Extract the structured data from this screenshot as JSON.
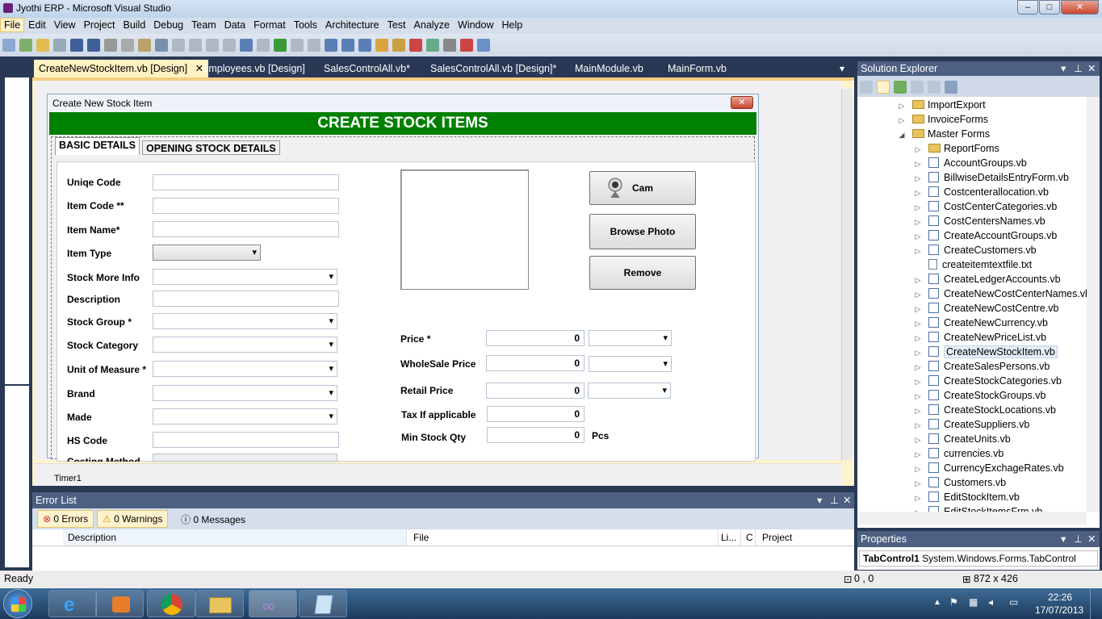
{
  "window": {
    "title": "Jyothi ERP - Microsoft Visual Studio",
    "min": "–",
    "max": "□",
    "close": "✕"
  },
  "menu": [
    "File",
    "Edit",
    "View",
    "Project",
    "Build",
    "Debug",
    "Team",
    "Data",
    "Format",
    "Tools",
    "Architecture",
    "Test",
    "Analyze",
    "Window",
    "Help"
  ],
  "doc_tabs": [
    {
      "label": "CreateNewStockItem.vb [Design]",
      "active": true
    },
    {
      "label": "Employees.vb [Design]"
    },
    {
      "label": "SalesControlAll.vb*"
    },
    {
      "label": "SalesControlAll.vb [Design]*"
    },
    {
      "label": "MainModule.vb"
    },
    {
      "label": "MainForm.vb"
    }
  ],
  "form": {
    "title": "Create New Stock Item",
    "banner": "CREATE STOCK ITEMS",
    "tabs": [
      "BASIC DETAILS",
      "OPENING STOCK DETAILS"
    ],
    "labels": {
      "uniq_code": "Uniqe Code",
      "item_code": "Item Code **",
      "item_name": "Item Name*",
      "item_type": "Item Type",
      "stock_more_info": "Stock More Info",
      "description": "Description",
      "stock_group": "Stock Group *",
      "stock_category": "Stock Category",
      "unit_of_measure": "Unit of Measure *",
      "brand": "Brand",
      "made": "Made",
      "hs_code": "HS Code",
      "costing_method": "Costing Method",
      "price": "Price *",
      "wholesale_price": "WholeSale Price",
      "retail_price": "Retail Price",
      "tax": "Tax If applicable",
      "min_stock": "Min Stock Qty",
      "pcs": "Pcs"
    },
    "values": {
      "price": "0",
      "wholesale_price": "0",
      "retail_price": "0",
      "tax": "0",
      "min_stock": "0"
    },
    "buttons": {
      "cam": "Cam",
      "browse": "Browse Photo",
      "remove": "Remove"
    },
    "component_tray": "Timer1"
  },
  "solution_explorer": {
    "title": "Solution Explorer",
    "items": [
      {
        "label": "ImportExport",
        "type": "folder",
        "indent": 1
      },
      {
        "label": "InvoiceForms",
        "type": "folder",
        "indent": 1
      },
      {
        "label": "Master Forms",
        "type": "folder",
        "indent": 1,
        "open": true
      },
      {
        "label": "ReportFoms",
        "type": "folder",
        "indent": 2
      },
      {
        "label": "AccountGroups.vb",
        "type": "vb",
        "indent": 2
      },
      {
        "label": "BillwiseDetailsEntryForm.vb",
        "type": "vb",
        "indent": 2
      },
      {
        "label": "Costcenterallocation.vb",
        "type": "vb",
        "indent": 2
      },
      {
        "label": "CostCenterCategories.vb",
        "type": "vb",
        "indent": 2
      },
      {
        "label": "CostCentersNames.vb",
        "type": "vb",
        "indent": 2
      },
      {
        "label": "CreateAccountGroups.vb",
        "type": "vb",
        "indent": 2
      },
      {
        "label": "CreateCustomers.vb",
        "type": "vb",
        "indent": 2
      },
      {
        "label": "createitemtextfile.txt",
        "type": "txt",
        "indent": 2
      },
      {
        "label": "CreateLedgerAccounts.vb",
        "type": "vb",
        "indent": 2
      },
      {
        "label": "CreateNewCostCenterNames.vb",
        "type": "vb",
        "indent": 2
      },
      {
        "label": "CreateNewCostCentre.vb",
        "type": "vb",
        "indent": 2
      },
      {
        "label": "CreateNewCurrency.vb",
        "type": "vb",
        "indent": 2
      },
      {
        "label": "CreateNewPriceList.vb",
        "type": "vb",
        "indent": 2
      },
      {
        "label": "CreateNewStockItem.vb",
        "type": "vb",
        "indent": 2,
        "selected": true
      },
      {
        "label": "CreateSalesPersons.vb",
        "type": "vb",
        "indent": 2
      },
      {
        "label": "CreateStockCategories.vb",
        "type": "vb",
        "indent": 2
      },
      {
        "label": "CreateStockGroups.vb",
        "type": "vb",
        "indent": 2
      },
      {
        "label": "CreateStockLocations.vb",
        "type": "vb",
        "indent": 2
      },
      {
        "label": "CreateSuppliers.vb",
        "type": "vb",
        "indent": 2
      },
      {
        "label": "CreateUnits.vb",
        "type": "vb",
        "indent": 2
      },
      {
        "label": "currencies.vb",
        "type": "vb",
        "indent": 2
      },
      {
        "label": "CurrencyExchageRates.vb",
        "type": "vb",
        "indent": 2
      },
      {
        "label": "Customers.vb",
        "type": "vb",
        "indent": 2
      },
      {
        "label": "EditStockItem.vb",
        "type": "vb",
        "indent": 2
      },
      {
        "label": "EditStockItemsFrm.vb",
        "type": "vb",
        "indent": 2
      }
    ]
  },
  "properties": {
    "title": "Properties",
    "object": "TabControl1",
    "type": "System.Windows.Forms.TabControl"
  },
  "error_list": {
    "title": "Error List",
    "errors": "0 Errors",
    "warnings": "0 Warnings",
    "messages": "0 Messages",
    "columns": [
      "Description",
      "File",
      "Li...",
      "C",
      "Project"
    ]
  },
  "status": {
    "text": "Ready",
    "position": "0 , 0",
    "size": "872 x 426"
  },
  "taskbar": {
    "time": "22:26",
    "date": "17/07/2013"
  }
}
